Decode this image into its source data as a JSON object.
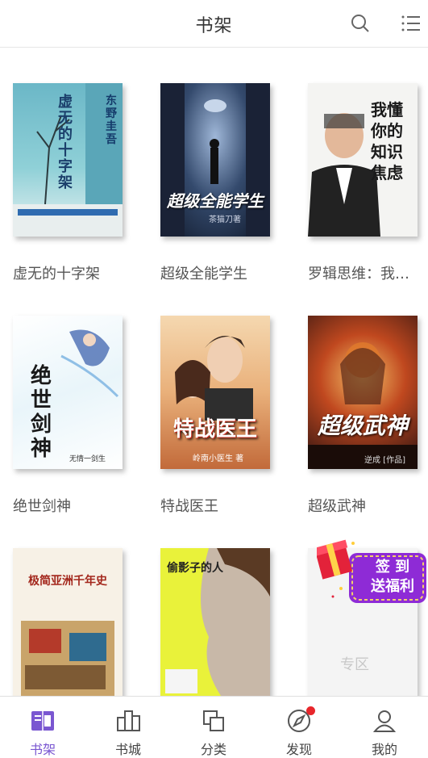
{
  "header": {
    "title": "书架"
  },
  "books": [
    {
      "name": "虚无的十字架",
      "cover_title": "虚无的十字架",
      "cover_author": "东野圭吾"
    },
    {
      "name": "超级全能学生",
      "cover_title": "超级全能学生",
      "cover_author": "茶猫刀著"
    },
    {
      "name": "罗辑思维：我懂你的知识焦虑",
      "cover_title": "我懂你的知识焦虑",
      "cover_author": ""
    },
    {
      "name": "绝世剑神",
      "cover_title": "绝世剑神",
      "cover_author": "无情一剑生"
    },
    {
      "name": "特战医王",
      "cover_title": "特战医王",
      "cover_author": "岭南小医生 著"
    },
    {
      "name": "超级武神",
      "cover_title": "超级武神",
      "cover_author": "逆成 [作品]"
    },
    {
      "name": "",
      "cover_title": "极简亚洲千年史",
      "cover_author": ""
    },
    {
      "name": "",
      "cover_title": "偷影子的人",
      "cover_author": ""
    },
    {
      "name": "",
      "cover_title": "专区",
      "cover_author": ""
    }
  ],
  "promo": {
    "line1": "签  到",
    "line2": "送福利"
  },
  "tabs": [
    {
      "label": "书架",
      "icon": "bookshelf-icon",
      "active": true
    },
    {
      "label": "书城",
      "icon": "bookstore-icon",
      "active": false
    },
    {
      "label": "分类",
      "icon": "category-icon",
      "active": false
    },
    {
      "label": "发现",
      "icon": "discover-icon",
      "active": false
    },
    {
      "label": "我的",
      "icon": "profile-icon",
      "active": false
    }
  ],
  "colors": {
    "accent": "#7a57d1",
    "badge": "#e8262b",
    "promo": "#8e2bd6"
  }
}
